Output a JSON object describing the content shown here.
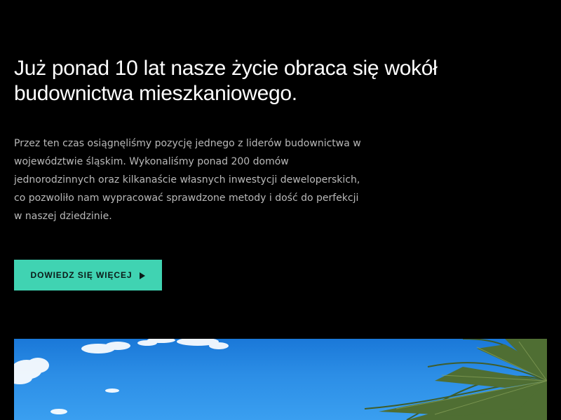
{
  "hero": {
    "headline": "Już ponad 10 lat nasze życie obraca się wokół\nbudownictwa mieszkaniowego.",
    "description": "Przez ten czas osiągnęliśmy pozycję jednego z liderów budownictwa w województwie śląskim. Wykonaliśmy ponad 200 domów jednorodzinnych oraz kilkanaście własnych inwestycji deweloperskich, co pozwoliło nam wypracować sprawdzone metody i dość do perfekcji w naszej dziedzinie.",
    "cta_label": "DOWIEDZ SIĘ WIĘCEJ",
    "cta_icon": "play-arrow-icon"
  },
  "photo": {
    "subject": "sky-with-clouds-and-palm"
  },
  "colors": {
    "background": "#000000",
    "headline": "#ffffff",
    "body_text": "#b9b9b9",
    "accent": "#40d3b2",
    "sky": "#2c8ee6",
    "palm": "#3f5d2a"
  }
}
